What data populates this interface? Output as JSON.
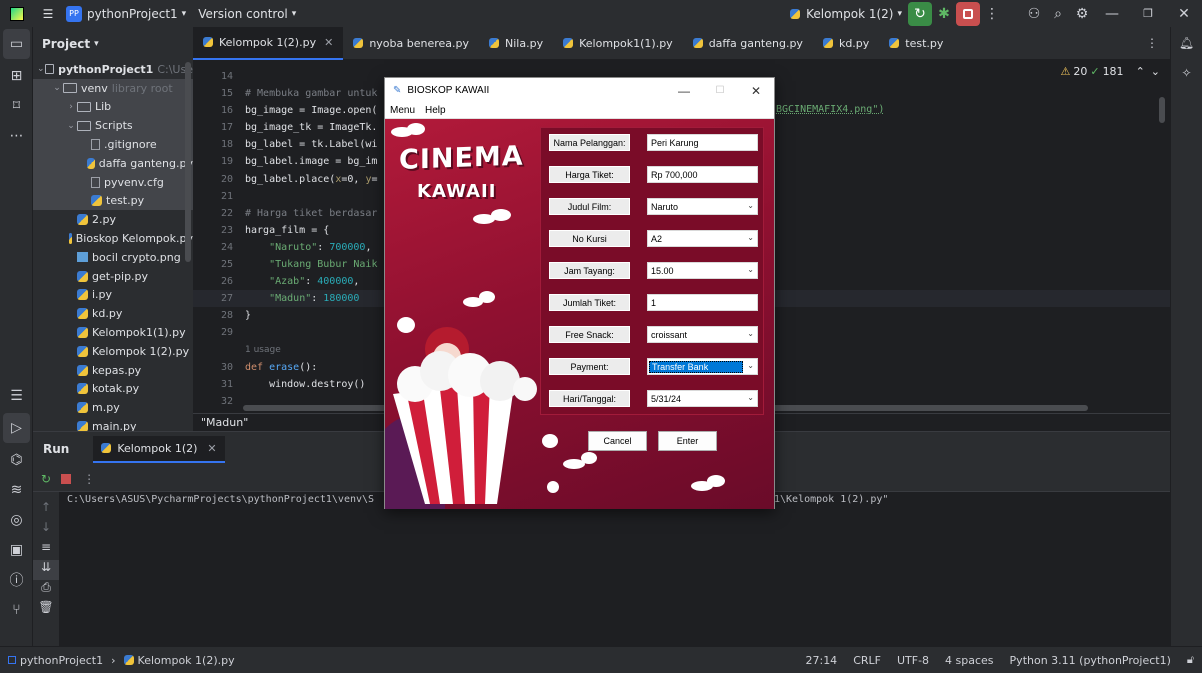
{
  "titlebar": {
    "project_badge": "PP",
    "project_name": "pythonProject1",
    "vcs": "Version control",
    "run_config": "Kelompok 1(2)"
  },
  "project_panel": {
    "title": "Project",
    "items": [
      {
        "label": "pythonProject1",
        "hint": "C:\\Use",
        "depth": 0,
        "kind": "folder"
      },
      {
        "label": "venv",
        "hint": "library root",
        "depth": 1,
        "kind": "folder"
      },
      {
        "label": "Lib",
        "hint": "",
        "depth": 2,
        "kind": "folder"
      },
      {
        "label": "Scripts",
        "hint": "",
        "depth": 2,
        "kind": "folder"
      },
      {
        "label": ".gitignore",
        "hint": "",
        "depth": 3,
        "kind": "file"
      },
      {
        "label": "daffa ganteng.py",
        "hint": "",
        "depth": 3,
        "kind": "py"
      },
      {
        "label": "pyvenv.cfg",
        "hint": "",
        "depth": 3,
        "kind": "file"
      },
      {
        "label": "test.py",
        "hint": "",
        "depth": 3,
        "kind": "py"
      },
      {
        "label": "2.py",
        "hint": "",
        "depth": 2,
        "kind": "py"
      },
      {
        "label": "Bioskop Kelompok.py",
        "hint": "",
        "depth": 2,
        "kind": "py"
      },
      {
        "label": "bocil crypto.png",
        "hint": "",
        "depth": 2,
        "kind": "img"
      },
      {
        "label": "get-pip.py",
        "hint": "",
        "depth": 2,
        "kind": "py"
      },
      {
        "label": "i.py",
        "hint": "",
        "depth": 2,
        "kind": "py"
      },
      {
        "label": "kd.py",
        "hint": "",
        "depth": 2,
        "kind": "py"
      },
      {
        "label": "Kelompok1(1).py",
        "hint": "",
        "depth": 2,
        "kind": "py"
      },
      {
        "label": "Kelompok 1(2).py",
        "hint": "",
        "depth": 2,
        "kind": "py"
      },
      {
        "label": "kepas.py",
        "hint": "",
        "depth": 2,
        "kind": "py"
      },
      {
        "label": "kotak.py",
        "hint": "",
        "depth": 2,
        "kind": "py"
      },
      {
        "label": "m.py",
        "hint": "",
        "depth": 2,
        "kind": "py"
      },
      {
        "label": "main.py",
        "hint": "",
        "depth": 2,
        "kind": "py"
      }
    ]
  },
  "tabs": [
    "Kelompok 1(2).py",
    "nyoba benerea.py",
    "Nila.py",
    "Kelompok1(1).py",
    "daffa ganteng.py",
    "kd.py",
    "test.py"
  ],
  "editor": {
    "inspections_warn": "20",
    "inspections_ok": "181",
    "lines": [
      {
        "no": "14",
        "code": ""
      },
      {
        "no": "15",
        "code": "# Membuka gambar untuk"
      },
      {
        "no": "16",
        "code": "bg_image = Image.open("
      },
      {
        "no": "17",
        "code": "bg_image_tk = ImageTk."
      },
      {
        "no": "18",
        "code": "bg_label = tk.Label(wi"
      },
      {
        "no": "19",
        "code": "bg_label.image = bg_im"
      },
      {
        "no": "20",
        "code": "bg_label.place(x=0, y="
      },
      {
        "no": "21",
        "code": ""
      },
      {
        "no": "22",
        "code": "# Harga tiket berdasar"
      },
      {
        "no": "23",
        "code": "harga_film = {"
      },
      {
        "no": "24",
        "code": "    \"Naruto\": 700000,"
      },
      {
        "no": "25",
        "code": "    \"Tukang Bubur Naik"
      },
      {
        "no": "26",
        "code": "    \"Azab\": 400000,"
      },
      {
        "no": "27",
        "code": "    \"Madun\": 180000"
      },
      {
        "no": "28",
        "code": "}"
      },
      {
        "no": "29",
        "code": ""
      },
      {
        "no": "",
        "code": "1 usage"
      },
      {
        "no": "30",
        "code": "def erase():"
      },
      {
        "no": "31",
        "code": "    window.destroy()"
      },
      {
        "no": "32",
        "code": ""
      }
    ],
    "right_fragment": "BGCINEMAFIX4.png\")",
    "breadcrumb": "\"Madun\""
  },
  "run_panel": {
    "tab_run": "Run",
    "tab_config": "Kelompok 1(2)",
    "output_left": "C:\\Users\\ASUS\\PycharmProjects\\pythonProject1\\venv\\S",
    "output_right": "1\\Kelompok 1(2).py\""
  },
  "statusbar": {
    "project": "pythonProject1",
    "file": "Kelompok 1(2).py",
    "position": "27:14",
    "line_sep": "CRLF",
    "encoding": "UTF-8",
    "indent": "4 spaces",
    "interpreter": "Python 3.11 (pythonProject1)"
  },
  "tk_window": {
    "title": "BIOSKOP KAWAII",
    "menu": [
      "Menu",
      "Help"
    ],
    "logo_line1": "CINEMA",
    "logo_line2": "KAWAII",
    "fields": [
      {
        "label": "Nama Pelanggan:",
        "value": "Peri Karung",
        "dropdown": false
      },
      {
        "label": "Harga Tiket:",
        "value": "Rp 700,000",
        "dropdown": false
      },
      {
        "label": "Judul Film:",
        "value": "Naruto",
        "dropdown": true
      },
      {
        "label": "No Kursi",
        "value": "A2",
        "dropdown": true
      },
      {
        "label": "Jam Tayang:",
        "value": "15.00",
        "dropdown": true
      },
      {
        "label": "Jumlah Tiket:",
        "value": "1",
        "dropdown": false
      },
      {
        "label": "Free Snack:",
        "value": "croissant",
        "dropdown": true
      },
      {
        "label": "Payment:",
        "value": "Transfer Bank",
        "dropdown": true
      },
      {
        "label": "Hari/Tanggal:",
        "value": "5/31/24",
        "dropdown": true
      }
    ],
    "cancel": "Cancel",
    "enter": "Enter"
  },
  "colors": {
    "accent": "#3574f0",
    "tk_bg": "#8f1030",
    "panel": "#2b2d30",
    "editor": "#1e1f22"
  }
}
